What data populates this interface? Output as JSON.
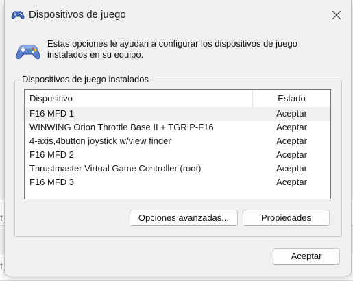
{
  "background": {
    "left_chars": [
      "t",
      "t"
    ]
  },
  "dialog": {
    "title": "Dispositivos de juego",
    "close_icon": "close-icon",
    "header_text": "Estas opciones le ayudan a configurar los dispositivos de juego instalados en su equipo.",
    "group_label": "Dispositivos de juego instalados",
    "columns": [
      "Dispositivo",
      "Estado"
    ],
    "devices": [
      {
        "name": "F16 MFD 1",
        "status": "Aceptar"
      },
      {
        "name": "WINWING Orion Throttle Base II + TGRIP-F16",
        "status": "Aceptar"
      },
      {
        "name": "4-axis,4button joystick w/view finder",
        "status": "Aceptar"
      },
      {
        "name": "F16 MFD 2",
        "status": "Aceptar"
      },
      {
        "name": "Thrustmaster Virtual Game Controller (root)",
        "status": "Aceptar"
      },
      {
        "name": "F16 MFD 3",
        "status": "Aceptar"
      }
    ],
    "selected_row": 0,
    "advanced_button": "Opciones avanzadas...",
    "properties_button": "Propiedades",
    "ok_button": "Aceptar"
  },
  "colors": {
    "accent": "#2b5fb3",
    "dialog_bg": "#f0f0f0"
  }
}
